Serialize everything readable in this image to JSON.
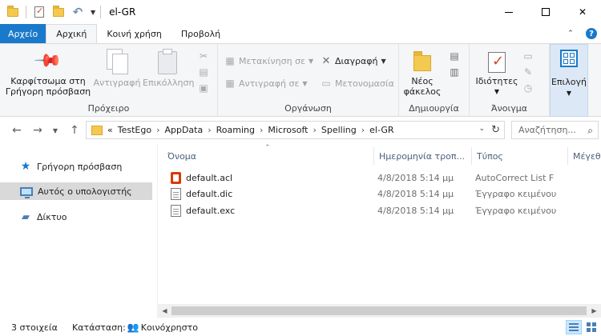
{
  "window": {
    "title": "el-GR",
    "minimize": "",
    "close": "✕"
  },
  "tabs": {
    "file": "Αρχείο",
    "home": "Αρχική",
    "share": "Κοινή χρήση",
    "view": "Προβολή"
  },
  "ribbon": {
    "clipboard": {
      "label": "Πρόχειρο",
      "pin": "Καρφίτσωμα στη Γρήγορη πρόσβαση",
      "copy": "Αντιγραφή",
      "paste": "Επικόλληση"
    },
    "organize": {
      "label": "Οργάνωση",
      "move_to": "Μετακίνηση σε",
      "copy_to": "Αντιγραφή σε",
      "delete": "Διαγραφή",
      "rename": "Μετονομασία"
    },
    "new": {
      "label": "Δημιουργία",
      "new_folder": "Νέος φάκελος"
    },
    "open": {
      "label": "Άνοιγμα",
      "properties": "Ιδιότητες"
    },
    "select": {
      "label": "Επιλογή"
    }
  },
  "address": {
    "overflow": "«",
    "crumbs": [
      "TestEgo",
      "AppData",
      "Roaming",
      "Microsoft",
      "Spelling",
      "el-GR"
    ],
    "search_placeholder": "Αναζήτηση..."
  },
  "nav_pane": {
    "items": [
      {
        "label": "Γρήγορη πρόσβαση",
        "icon": "star-icon"
      },
      {
        "label": "Αυτός ο υπολογιστής",
        "icon": "computer-icon",
        "selected": true
      },
      {
        "label": "Δίκτυο",
        "icon": "network-icon"
      }
    ]
  },
  "file_list": {
    "columns": [
      "Όνομα",
      "Ημερομηνία τροπ...",
      "Τύπος",
      "Μέγεθ"
    ],
    "rows": [
      {
        "name": "default.acl",
        "date": "4/8/2018 5:14 μμ",
        "type": "AutoCorrect List F",
        "icon": "office-file-icon"
      },
      {
        "name": "default.dic",
        "date": "4/8/2018 5:14 μμ",
        "type": "Έγγραφο κειμένου",
        "icon": "text-file-icon"
      },
      {
        "name": "default.exc",
        "date": "4/8/2018 5:14 μμ",
        "type": "Έγγραφο κειμένου",
        "icon": "text-file-icon"
      }
    ]
  },
  "status": {
    "count": "3 στοιχεία",
    "state_label": "Κατάσταση:",
    "state_value": "Κοινόχρηστο"
  },
  "colors": {
    "accent": "#1979ca",
    "ribbon_bg": "#f5f6f7",
    "nav_selected": "#d9d9d9"
  }
}
